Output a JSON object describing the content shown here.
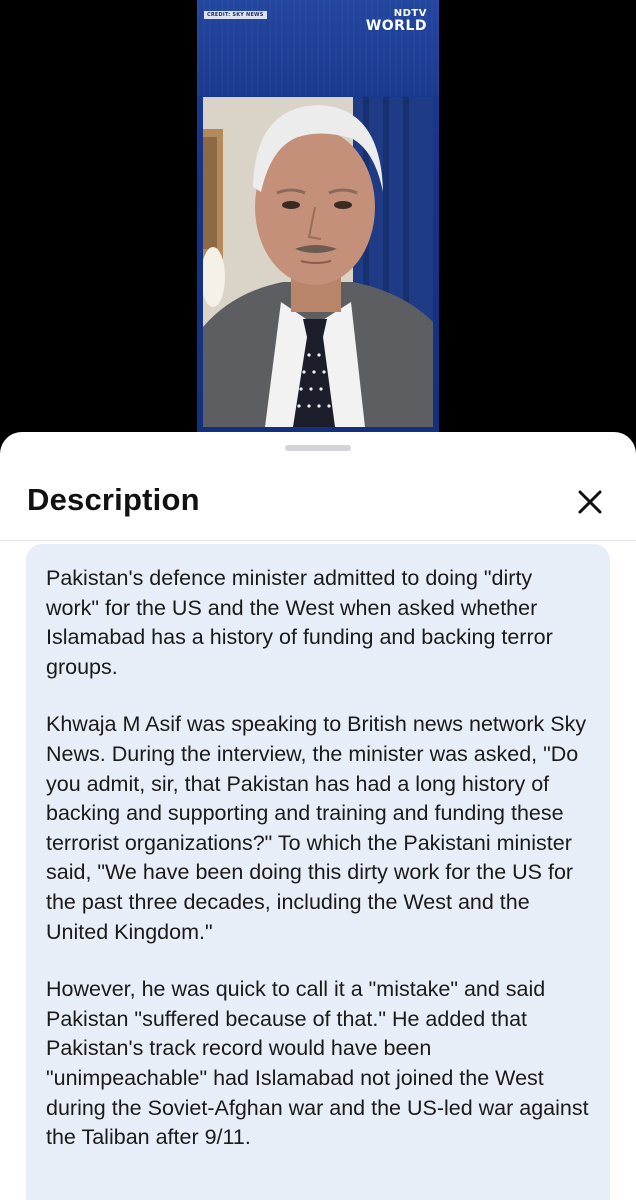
{
  "video": {
    "credit": "CREDIT: SKY NEWS",
    "logo_line1": "NDTV",
    "logo_line2": "WORLD"
  },
  "sheet": {
    "title": "Description",
    "close_icon": "close-icon",
    "paragraphs": [
      "Pakistan's defence minister admitted to doing \"dirty work\" for the US and the West when asked whether Islamabad has a history of funding and backing terror groups.",
      "Khwaja M Asif was speaking to British news network Sky News. During the interview, the minister was asked, \"Do you admit, sir, that Pakistan has had a long history of backing and supporting and training and funding these terrorist organizations?\" To which the Pakistani minister said, \"We have been doing this dirty work for the US for the past three decades, including the West and the United Kingdom.\"",
      "However, he was quick to call it a \"mistake\" and said Pakistan \"suffered because of that.\" He added that Pakistan's track record would have been \"unimpeachable\" had Islamabad not joined the West during the Soviet-Afghan war and the US-led war against the Taliban after 9/11."
    ]
  },
  "colors": {
    "video_background": "#1a3a8e",
    "card_background": "#e8eef8",
    "text": "#1a1a1a"
  }
}
